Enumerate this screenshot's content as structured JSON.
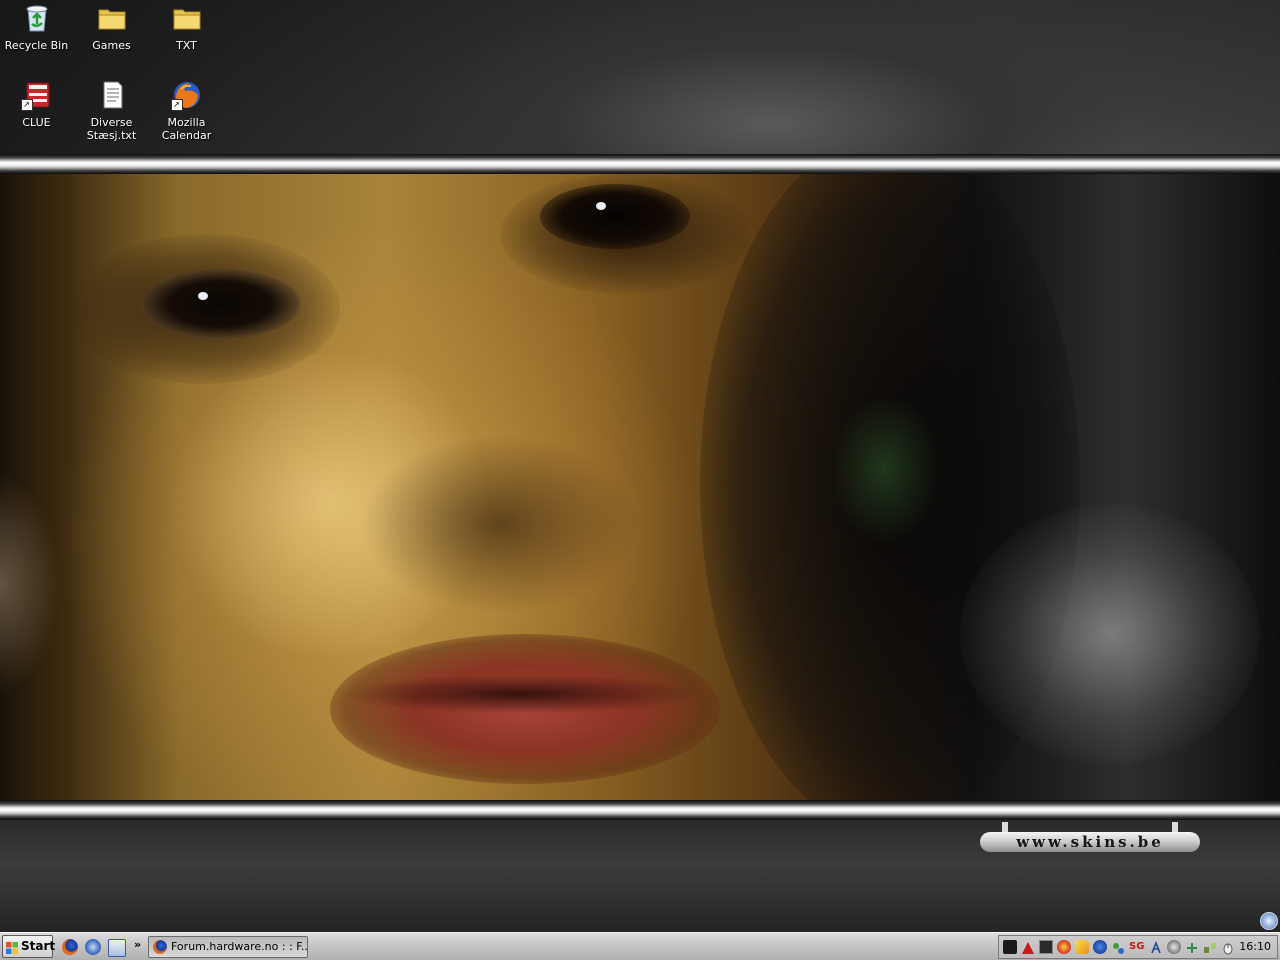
{
  "desktop": {
    "icons": [
      {
        "label": "Recycle Bin",
        "icon": "recycle-bin-icon"
      },
      {
        "label": "Games",
        "icon": "folder-icon"
      },
      {
        "label": "TXT",
        "icon": "folder-icon"
      },
      {
        "label": "CLUE",
        "icon": "clue-shortcut-icon"
      },
      {
        "label": "Diverse Stæsj.txt",
        "icon": "text-file-icon"
      },
      {
        "label": "Mozilla Calendar",
        "icon": "firefox-shortcut-icon"
      }
    ],
    "wallpaper_watermark": "www.skins.be"
  },
  "taskbar": {
    "start_label": "Start",
    "quick_launch": [
      "firefox-icon",
      "thunderbird-icon",
      "calendar-icon"
    ],
    "chevron": "»",
    "tasks": [
      {
        "label": "Forum.hardware.no : : F...",
        "icon": "firefox-icon",
        "active": true
      }
    ],
    "tray": {
      "icons": [
        "steam-icon",
        "acrobat-icon",
        "monitor-icon",
        "antivirus-icon",
        "chat-icon",
        "messenger-icon",
        "network-icon",
        "sg-icon",
        "settings-icon",
        "audio-icon",
        "sync-icon",
        "connection-icon",
        "mouse-icon"
      ],
      "sg_text": "SG",
      "time": "16:10"
    }
  }
}
